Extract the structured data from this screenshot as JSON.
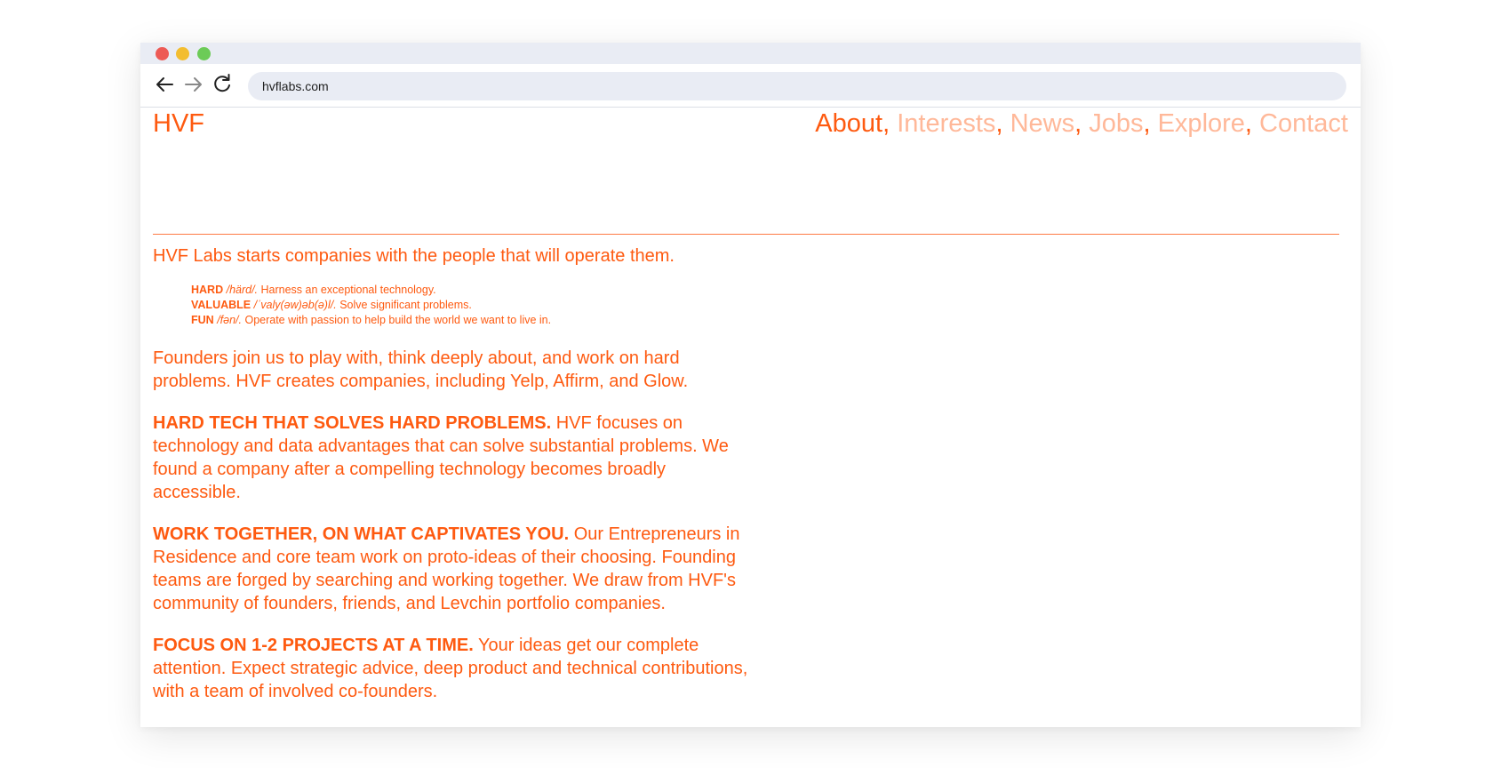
{
  "browser": {
    "url": "hvflabs.com"
  },
  "site": {
    "logo": "HVF",
    "nav": [
      "About",
      "Interests",
      "News",
      "Jobs",
      "Explore",
      "Contact"
    ],
    "nav_active": "About",
    "separator": ","
  },
  "content": {
    "intro": "HVF Labs starts companies with the people that will operate them.",
    "definitions": [
      {
        "term": "HARD",
        "pron": "/härd/.",
        "text": "Harness an exceptional technology."
      },
      {
        "term": "VALUABLE",
        "pron": "/ˈvaly(əw)əb(ə)l/.",
        "text": "Solve significant problems."
      },
      {
        "term": "FUN",
        "pron": "/fən/.",
        "text": "Operate with passion to help build the world we want to live in."
      }
    ],
    "founders": "Founders join us to play with, think deeply about, and work on hard problems. HVF creates companies, including Yelp, Affirm, and Glow.",
    "sections": [
      {
        "heading": "HARD TECH THAT SOLVES HARD PROBLEMS.",
        "body": "HVF focuses on technology and data advantages that can solve substantial problems. We found a company after a compelling technology becomes broadly accessible."
      },
      {
        "heading": "WORK TOGETHER, ON WHAT CAPTIVATES YOU.",
        "body": "Our Entrepreneurs in Residence and core team work on proto-ideas of their choosing. Founding teams are forged by searching and working together. We draw from HVF's community of founders, friends, and Levchin portfolio companies."
      },
      {
        "heading": "FOCUS ON 1-2 PROJECTS AT A TIME.",
        "body": "Your ideas get our complete attention. Expect strategic advice, deep product and technical contributions, with a team of involved co-founders."
      }
    ]
  },
  "colors": {
    "accent": "#fe5a10",
    "nav_inactive": "#ffb899",
    "chrome": "#e9ecf4"
  },
  "icons": [
    "back-arrow-icon",
    "forward-arrow-icon",
    "reload-icon"
  ]
}
